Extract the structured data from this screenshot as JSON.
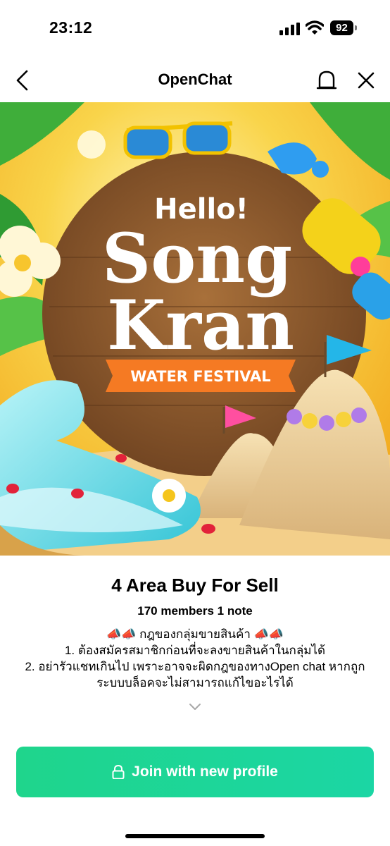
{
  "status_bar": {
    "time": "23:12",
    "battery": "92"
  },
  "nav": {
    "title": "OpenChat"
  },
  "banner": {
    "hello": "Hello!",
    "song": "Song",
    "kran": "Kran",
    "festival": "WATER FESTIVAL"
  },
  "group": {
    "name": "4 Area Buy For Sell",
    "meta": "170 members 1 note",
    "description_lines": [
      "📣📣 กฎของกลุ่มขายสินค้า 📣📣",
      "1. ต้องสมัครสมาชิกก่อนที่จะลงขายสินค้าในกลุ่มได้",
      "2. อย่ารัวแชทเกินไป เพราะอาจจะผิดกฎของทางOpen chat หากถูก",
      "ระบบบล็อคจะไม่สามารถแก้ไขอะไรได้"
    ]
  },
  "join_button": {
    "label": "Join with new profile"
  },
  "colors": {
    "accent": "#1fd58c",
    "banner_sky": "#f7c738",
    "wood": "#8b5a2b"
  },
  "icons": [
    "back-icon",
    "bell-icon",
    "close-icon",
    "lock-icon",
    "chevron-down-icon"
  ]
}
